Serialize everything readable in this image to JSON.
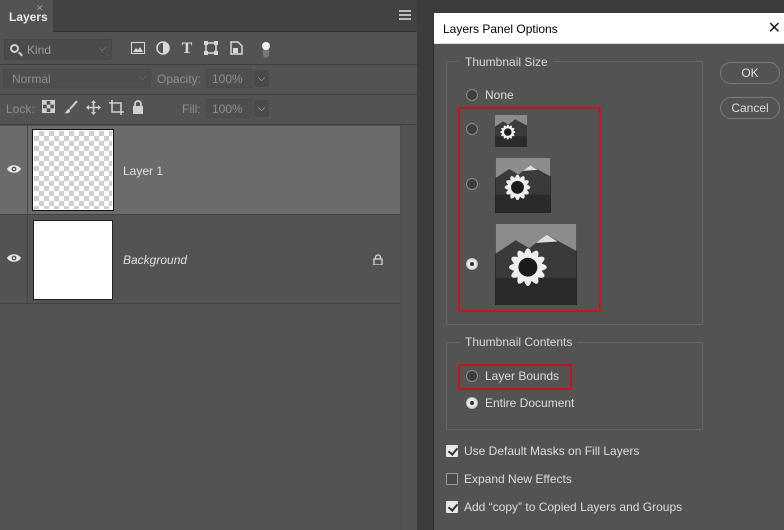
{
  "panel": {
    "tab": "Layers",
    "filter_kind": "Kind",
    "blend_mode": "Normal",
    "opacity_label": "Opacity:",
    "opacity_value": "100%",
    "lock_label": "Lock:",
    "fill_label": "Fill:",
    "fill_value": "100%",
    "layers": [
      {
        "name": "Layer 1",
        "visible": true,
        "selected": true
      },
      {
        "name": "Background",
        "visible": true,
        "locked": true
      }
    ]
  },
  "dialog": {
    "title": "Layers Panel Options",
    "thumb_size_label": "Thumbnail Size",
    "thumb_sizes": [
      {
        "label": "None",
        "selected": false
      },
      {
        "label": "",
        "selected": false
      },
      {
        "label": "",
        "selected": false
      },
      {
        "label": "",
        "selected": true
      }
    ],
    "thumb_contents_label": "Thumbnail Contents",
    "contents": [
      {
        "label": "Layer Bounds",
        "selected": false
      },
      {
        "label": "Entire Document",
        "selected": true
      }
    ],
    "checkboxes": [
      {
        "label": "Use Default Masks on Fill Layers",
        "checked": true
      },
      {
        "label": "Expand New Effects",
        "checked": false
      },
      {
        "label": "Add “copy” to Copied Layers and Groups",
        "checked": true
      }
    ],
    "ok": "OK",
    "cancel": "Cancel",
    "highlight_color": "#c4151c"
  }
}
